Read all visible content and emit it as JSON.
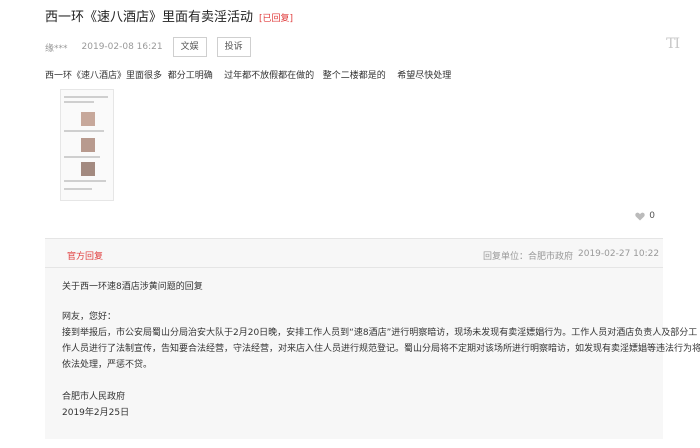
{
  "post": {
    "title": "西一环《速八酒店》里面有卖淫活动",
    "status": "[已回复]",
    "author": "缘***",
    "time": "2019-02-08 16:21",
    "content": "西一环《速八酒店》里面很多  都分工明确    过年都不放假都在做的   整个二楼都是的    希望尽快处理"
  },
  "actions": {
    "article_label": "文娱",
    "complaint_label": "投诉"
  },
  "font_toggle": "TI",
  "like_count": "0",
  "reply": {
    "official_label": "官方回复",
    "unit": "回复单位：合肥市政府",
    "time": "2019-02-27 10:22",
    "subject": "关于西一环速8酒店涉黄问题的回复",
    "greeting": "网友，您好：",
    "body_line1": "接到举报后，市公安局蜀山分局治安大队于2月20日晚，安排工作人员到“速8酒店”进行明察暗访，现场未发现有卖淫嫖娼行为。工作人员对酒店负责人及部分工",
    "body_line2": "作人员进行了法制宣传，告知要合法经营，守法经营，对来店入住人员进行规范登记。蜀山分局将不定期对该场所进行明察暗访，如发现有卖淫嫖娼等违法行为将",
    "body_line3": "依法处理，严惩不贷。",
    "signature": "合肥市人民政府",
    "date": "2019年2月25日"
  },
  "colors": {
    "accent": "#e03c3c",
    "muted": "#999999",
    "panel": "#f7f7f7"
  }
}
